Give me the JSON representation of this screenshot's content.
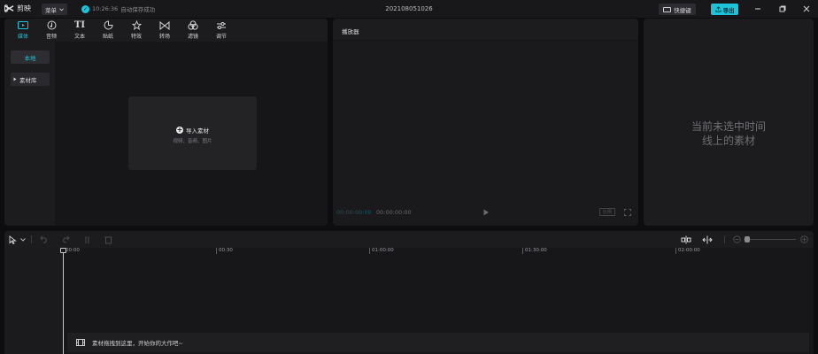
{
  "titlebar": {
    "app_name": "剪映",
    "menu_label": "菜单",
    "save_time": "10:26:36",
    "save_status": "自动保存成功",
    "project_title": "202108051026",
    "shortcut_label": "快捷键",
    "export_label": "导出"
  },
  "media": {
    "tabs": [
      {
        "label": "媒体",
        "icon": "media-icon",
        "active": true
      },
      {
        "label": "音频",
        "icon": "audio-icon"
      },
      {
        "label": "文本",
        "icon": "text-icon"
      },
      {
        "label": "贴纸",
        "icon": "sticker-icon"
      },
      {
        "label": "特效",
        "icon": "effects-icon"
      },
      {
        "label": "转场",
        "icon": "transition-icon"
      },
      {
        "label": "滤镜",
        "icon": "filter-icon"
      },
      {
        "label": "调节",
        "icon": "adjust-icon"
      }
    ],
    "side": {
      "local_label": "本地",
      "library_label": "素材库"
    },
    "import": {
      "label": "导入素材",
      "sublabel": "视频、音频、图片"
    }
  },
  "player": {
    "title": "播放器",
    "current_time": "00:00:00:00",
    "total_time": "00:00:00:00",
    "ratio_label": "比例"
  },
  "attributes": {
    "empty_line1": "当前未选中时间",
    "empty_line2": "线上的素材"
  },
  "timeline": {
    "ruler_ticks": [
      "00:00",
      "00:30",
      "01:00:00",
      "01:30:00",
      "02:00:00"
    ],
    "drop_hint": "素材拖拽到这里，开始你的大作吧~"
  },
  "colors": {
    "accent": "#1ec3d9",
    "background": "#0d0d0f",
    "panel": "#1c1c1e"
  }
}
